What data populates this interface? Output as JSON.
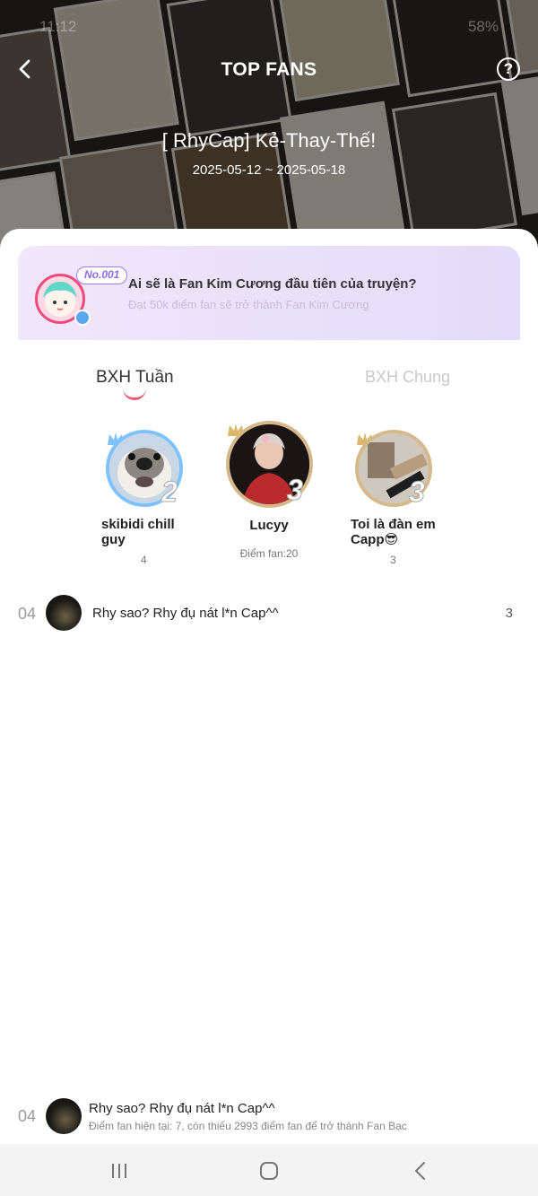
{
  "status": {
    "time": "11:12",
    "battery": "58%"
  },
  "header": {
    "title": "TOP FANS",
    "story_title": "[ RhyCap] Kẻ-Thay-Thế!",
    "date_range": "2025-05-12 ~ 2025-05-18",
    "help_glyph": "?"
  },
  "banner": {
    "badge": "No.001",
    "title": "Ai sẽ là Fan Kim Cương đầu tiên của truyện?",
    "subtitle": "Đạt 50k điểm fan sẽ trở thành Fan Kim Cương"
  },
  "tabs": [
    {
      "label": "BXH Tuần",
      "active": true
    },
    {
      "label": "BXH Chung",
      "active": false
    }
  ],
  "podium": [
    {
      "rank": "2",
      "name": "skibidi chill guy",
      "score": "4",
      "ring": "#5aa8f0"
    },
    {
      "rank": "3",
      "name": "Lucyy",
      "score": "Điểm fan:20",
      "ring": "#d6b98a"
    },
    {
      "rank": "3",
      "name": "Toi là đàn em Capp😎",
      "score": "3",
      "ring": "#d6b98a"
    }
  ],
  "list": [
    {
      "rank": "04",
      "name": "Rhy sao? Rhy đụ nát l*n Cap^^",
      "score": "3"
    }
  ],
  "me": {
    "rank": "04",
    "name": "Rhy sao? Rhy đụ nát l*n Cap^^",
    "status": "Điểm fan hiện tại: 7, còn thiếu 2993 điểm fan để trở thành Fan Bạc"
  },
  "colors": {
    "accent": "#ea5b78",
    "banner_start": "#f1e7fb",
    "banner_end": "#e3dcfa",
    "gold": "#d6b98a",
    "silver_blue": "#5aa8f0"
  }
}
